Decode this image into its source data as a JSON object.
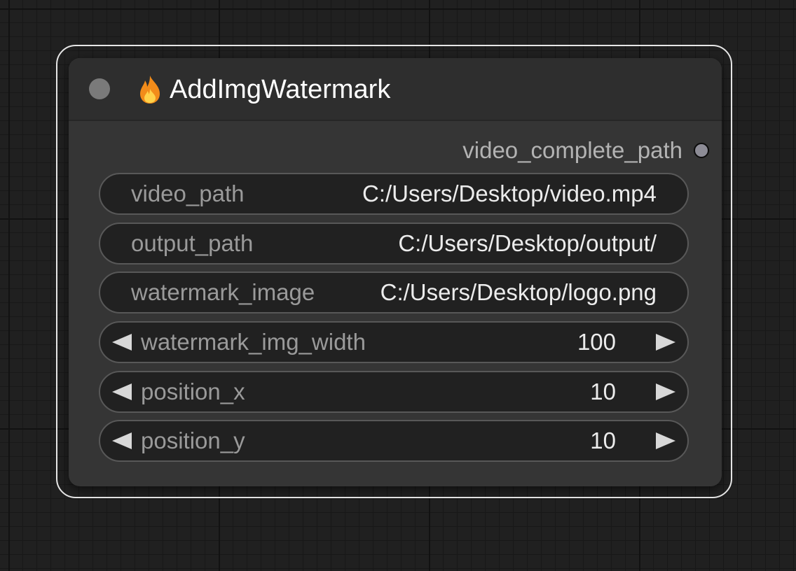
{
  "node": {
    "title": "AddImgWatermark",
    "title_icon": "flame-icon",
    "output": {
      "label": "video_complete_path"
    },
    "text_widgets": [
      {
        "label": "video_path",
        "value": "C:/Users/Desktop/video.mp4"
      },
      {
        "label": "output_path",
        "value": "C:/Users/Desktop/output/"
      },
      {
        "label": "watermark_image",
        "value": "C:/Users/Desktop/logo.png"
      }
    ],
    "number_widgets": [
      {
        "label": "watermark_img_width",
        "value": "100"
      },
      {
        "label": "position_x",
        "value": "10"
      },
      {
        "label": "position_y",
        "value": "10"
      }
    ]
  },
  "colors": {
    "canvas_background": "#202020",
    "node_body": "#353535",
    "node_header": "#2e2e2e",
    "selection_outline": "#e6e6e6",
    "widget_background": "#212121",
    "widget_border": "#585858",
    "flame_outer": "#f28c1a",
    "flame_inner": "#ffd24a"
  }
}
